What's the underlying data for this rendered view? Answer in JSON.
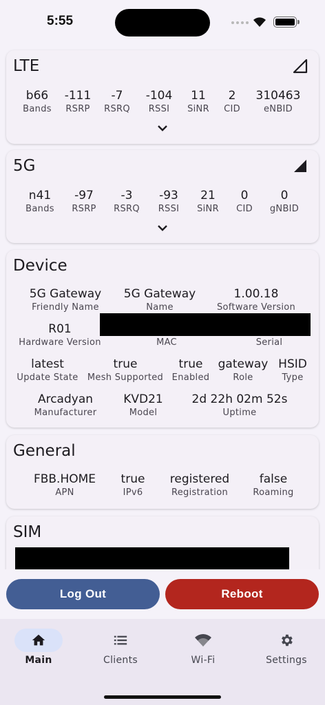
{
  "status_bar": {
    "time": "5:55"
  },
  "lte": {
    "title": "LTE",
    "metrics": [
      {
        "value": "b66",
        "label": "Bands"
      },
      {
        "value": "-111",
        "label": "RSRP"
      },
      {
        "value": "-7",
        "label": "RSRQ"
      },
      {
        "value": "-104",
        "label": "RSSI"
      },
      {
        "value": "11",
        "label": "SiNR"
      },
      {
        "value": "2",
        "label": "CID"
      },
      {
        "value": "310463",
        "label": "eNBID"
      }
    ]
  },
  "fiveg": {
    "title": "5G",
    "metrics": [
      {
        "value": "n41",
        "label": "Bands"
      },
      {
        "value": "-97",
        "label": "RSRP"
      },
      {
        "value": "-3",
        "label": "RSRQ"
      },
      {
        "value": "-93",
        "label": "RSSI"
      },
      {
        "value": "21",
        "label": "SiNR"
      },
      {
        "value": "0",
        "label": "CID"
      },
      {
        "value": "0",
        "label": "gNBID"
      }
    ]
  },
  "device": {
    "title": "Device",
    "friendly_name": {
      "value": "5G Gateway",
      "label": "Friendly Name"
    },
    "name": {
      "value": "5G Gateway",
      "label": "Name"
    },
    "software_version": {
      "value": "1.00.18",
      "label": "Software Version"
    },
    "hardware_version": {
      "value": "R01",
      "label": "Hardware Version"
    },
    "mac": {
      "label": "MAC"
    },
    "serial": {
      "label": "Serial"
    },
    "update_state": {
      "value": "latest",
      "label": "Update State"
    },
    "mesh_supported": {
      "value": "true",
      "label": "Mesh Supported"
    },
    "enabled": {
      "value": "true",
      "label": "Enabled"
    },
    "role": {
      "value": "gateway",
      "label": "Role"
    },
    "type": {
      "value": "HSID",
      "label": "Type"
    },
    "manufacturer": {
      "value": "Arcadyan",
      "label": "Manufacturer"
    },
    "model": {
      "value": "KVD21",
      "label": "Model"
    },
    "uptime": {
      "value": "2d 22h 02m 52s",
      "label": "Uptime"
    }
  },
  "general": {
    "title": "General",
    "metrics": [
      {
        "value": "FBB.HOME",
        "label": "APN"
      },
      {
        "value": "true",
        "label": "IPv6"
      },
      {
        "value": "registered",
        "label": "Registration"
      },
      {
        "value": "false",
        "label": "Roaming"
      }
    ]
  },
  "sim": {
    "title": "SIM"
  },
  "actions": {
    "logout_label": "Log Out",
    "reboot_label": "Reboot"
  },
  "nav": [
    {
      "label": "Main",
      "icon": "home-icon"
    },
    {
      "label": "Clients",
      "icon": "list-icon"
    },
    {
      "label": "Wi-Fi",
      "icon": "wifi-icon"
    },
    {
      "label": "Settings",
      "icon": "gear-icon"
    }
  ],
  "colors": {
    "background": "#f5f2f9",
    "card": "#f4f0f7",
    "logout_button": "#435e94",
    "reboot_button": "#b3261e",
    "nav_active_pill": "#dae2f9"
  }
}
